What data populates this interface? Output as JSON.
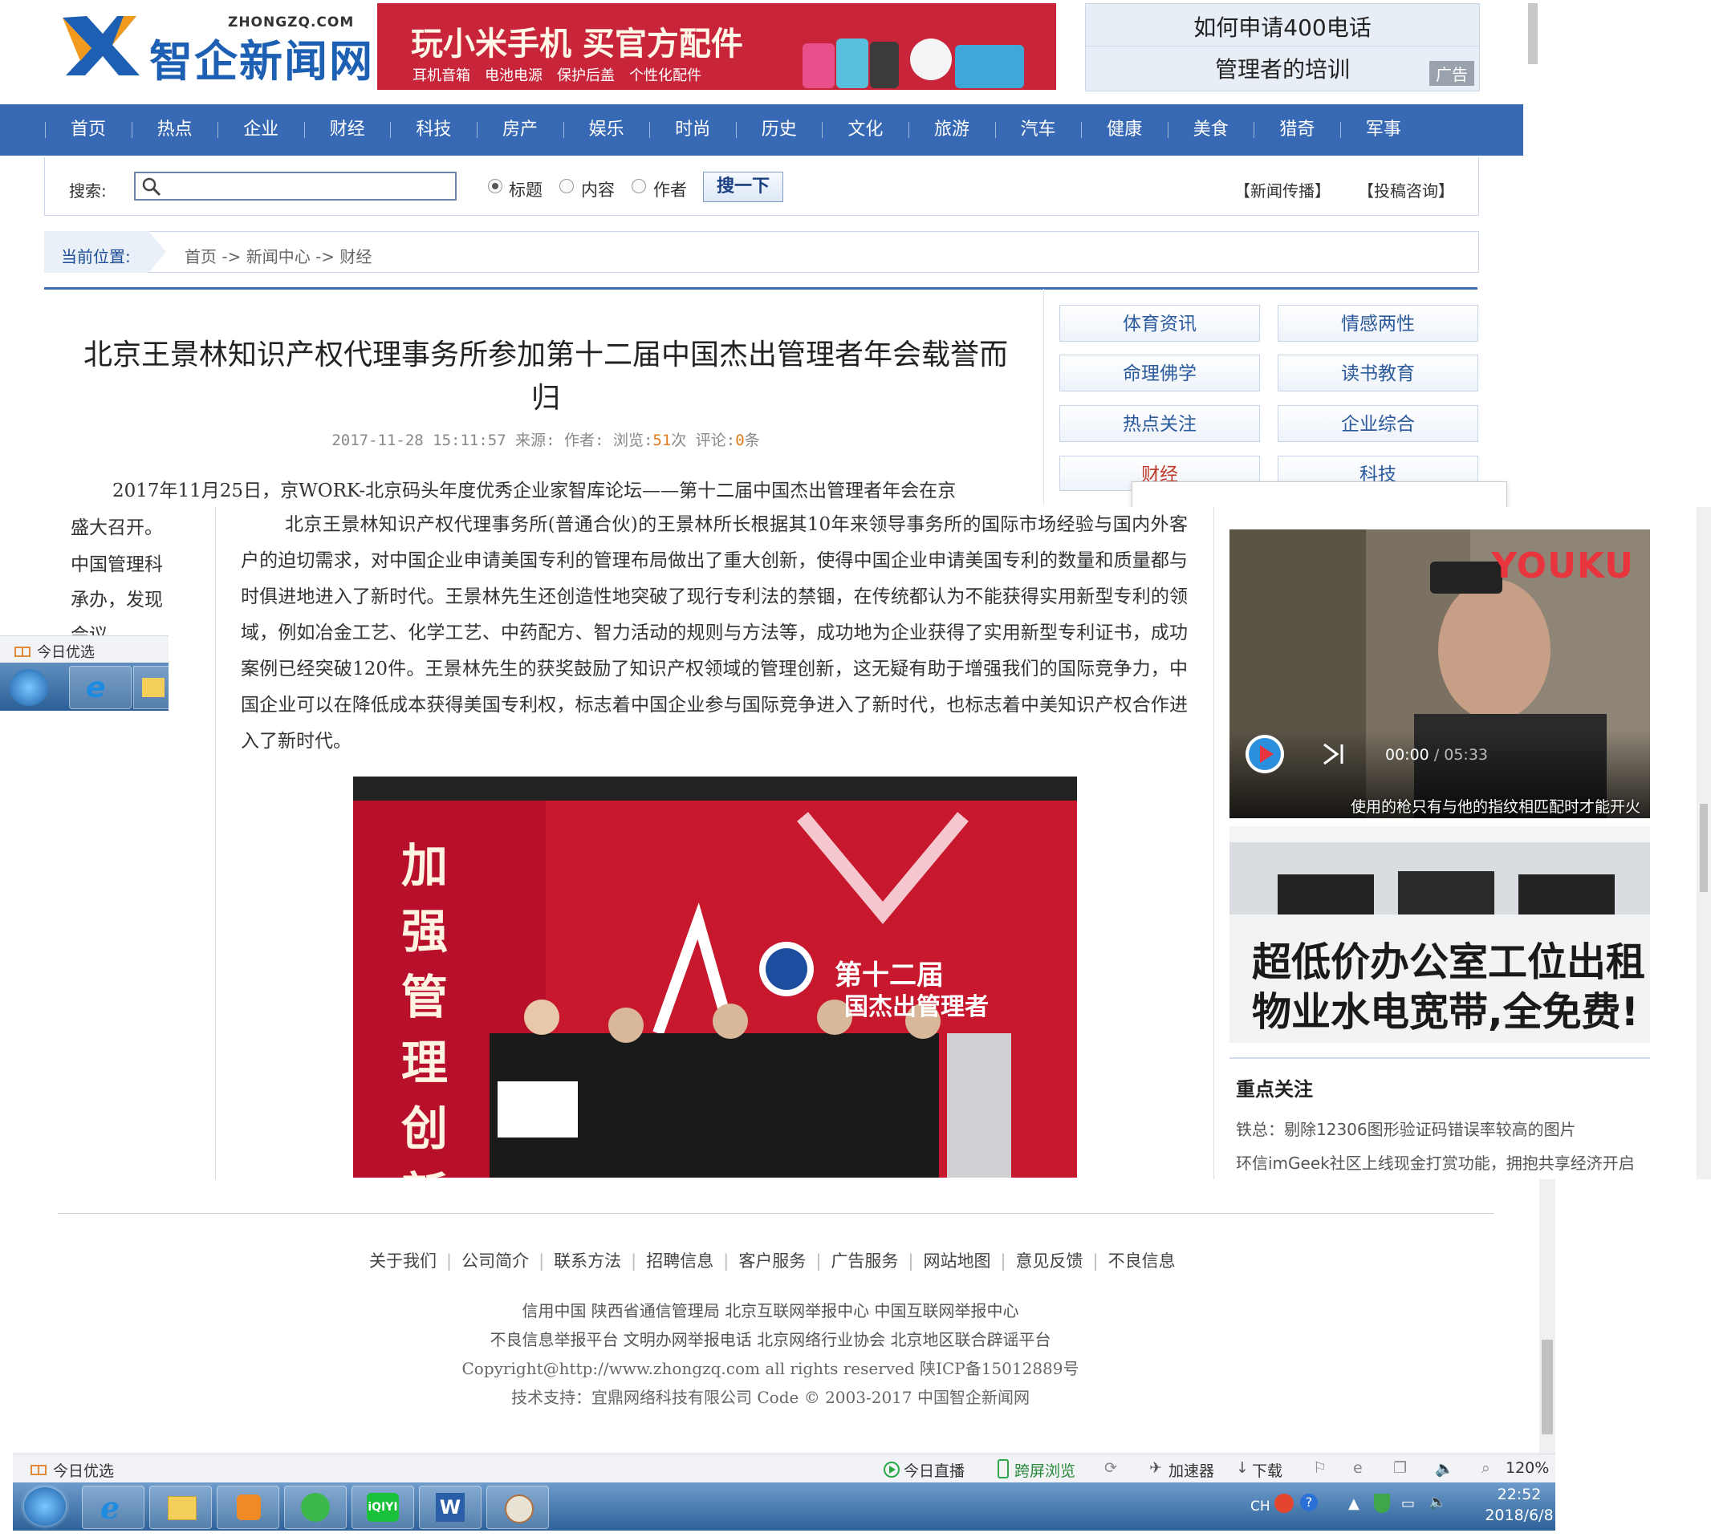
{
  "header": {
    "logo_en": "ZHONGZQ.COM",
    "logo_cn": "智企新闻网",
    "banner_title": "玩小米手机 买官方配件",
    "banner_sub": "耳机音箱　电池电源　保护后盖　个性化配件",
    "ad_line1": "如何申请400电话",
    "ad_line2": "管理者的培训",
    "ad_tag": "广告"
  },
  "nav": [
    "首页",
    "热点",
    "企业",
    "财经",
    "科技",
    "房产",
    "娱乐",
    "时尚",
    "历史",
    "文化",
    "旅游",
    "汽车",
    "健康",
    "美食",
    "猎奇",
    "军事"
  ],
  "search": {
    "label": "搜索:",
    "placeholder": "",
    "options": [
      "标题",
      "内容",
      "作者"
    ],
    "selected": "标题",
    "button": "搜一下",
    "link1": "【新闻传播】",
    "link2": "【投稿咨询】"
  },
  "breadcrumb": {
    "label": "当前位置:",
    "path": "首页 -> 新闻中心 -> 财经"
  },
  "article": {
    "title": "北京王景林知识产权代理事务所参加第十二届中国杰出管理者年会载誉而归",
    "meta_date": "2017-11-28 15:11:57",
    "meta_source": "来源:",
    "meta_author": "作者:",
    "meta_views_label": "浏览:",
    "meta_views": "51",
    "meta_views_unit": "次",
    "meta_comments_label": "评论:",
    "meta_comments": "0",
    "meta_comments_unit": "条",
    "para1": "2017年11月25日，京WORK-北京码头年度优秀企业家智库论坛——第十二届中国杰出管理者年会在京",
    "frag1": "盛大召开。",
    "frag2": "中国管理科",
    "frag3": "承办，发现",
    "frag4": "会议",
    "para2": "北京王景林知识产权代理事务所(普通合伙)的王景林所长根据其10年来领导事务所的国际市场经验与国内外客户的迫切需求，对中国企业申请美国专利的管理布局做出了重大创新，使得中国企业申请美国专利的数量和质量都与时俱进地进入了新时代。王景林先生还创造性地突破了现行专利法的禁锢，在传统都认为不能获得实用新型专利的领域，例如冶金工艺、化学工艺、中药配方、智力活动的规则与方法等，成功地为企业获得了实用新型专利证书，成功案例已经突破120件。王景林先生的获奖鼓励了知识产权领域的管理创新，这无疑有助于增强我们的国际竞争力，中国企业可以在降低成本获得美国专利权，标志着中国企业参与国际竞争进入了新时代，也标志着中美知识产权合作进入了新时代。",
    "photo_banner": "加强管理创新",
    "photo_logo": "第十二届",
    "photo_logo2": "国杰出管理者"
  },
  "sidebar": {
    "categories": [
      "体育资讯",
      "情感两性",
      "命理佛学",
      "读书教育",
      "热点关注",
      "企业综合",
      "财经",
      "科技"
    ],
    "video": {
      "brand": "YOUKU",
      "time_current": "00:00",
      "time_total": "/ 05:33",
      "caption": "使用的枪只有与他的指纹相匹配时才能开火"
    },
    "office_ad": [
      "超低价办公室工位出租",
      "物业水电宽带,全免费!"
    ],
    "focus_title": "重点关注",
    "focus_items": [
      "铁总：剔除12306图形验证码错误率较高的图片",
      "环信imGeek社区上线现金打赏功能，拥抱共享经济开启"
    ]
  },
  "footer": {
    "links": [
      "关于我们",
      "公司简介",
      "联系方法",
      "招聘信息",
      "客户服务",
      "广告服务",
      "网站地图",
      "意见反馈",
      "不良信息"
    ],
    "line1": "信用中国 陕西省通信管理局 北京互联网举报中心 中国互联网举报中心",
    "line2": "不良信息举报平台 文明办网举报电话 北京网络行业协会 北京地区联合辟谣平台",
    "line3": "Copyright@http://www.zhongzq.com all rights reserved 陕ICP备15012889号",
    "line4": "技术支持：宜鼎网络科技有限公司 Code © 2003-2017 中国智企新闻网"
  },
  "browser": {
    "fav_label": "今日优选",
    "live": "今日直播",
    "cross": "跨屏浏览",
    "accel": "加速器",
    "download": "下载",
    "zoom": "120%"
  },
  "taskbar": {
    "ime": "CH",
    "time": "22:52",
    "date": "2018/6/8"
  },
  "colors": {
    "nav_bg": "#3869b4",
    "accent": "#1d5fb3",
    "banner_bg": "#c8253a",
    "highlight": "#e07b1a"
  }
}
